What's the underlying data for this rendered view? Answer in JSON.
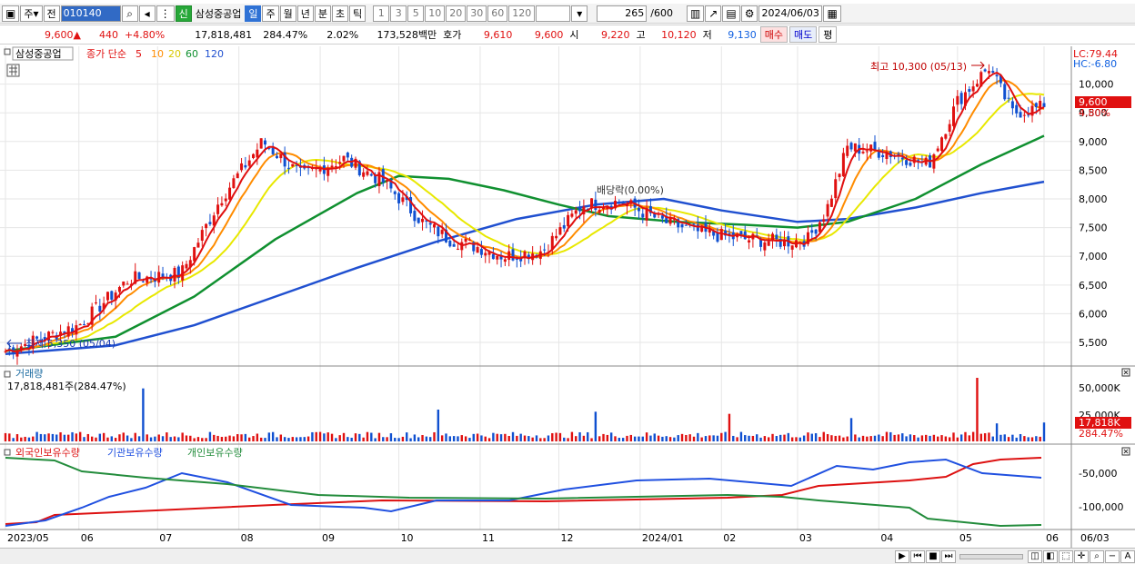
{
  "toolbar": {
    "market": "주",
    "period_btn": "전",
    "code": "010140",
    "stock_name": "삼성중공업",
    "new_badge": "신",
    "periods": [
      "일",
      "주",
      "월",
      "년",
      "분",
      "초",
      "틱"
    ],
    "selected_period": "일",
    "ticks": [
      "1",
      "3",
      "5",
      "10",
      "20",
      "30",
      "60",
      "120"
    ],
    "count": "265",
    "total": "/600",
    "date": "2024/06/03"
  },
  "quote": {
    "price": "9,600▲",
    "change": "440",
    "change_pct": "+4.80%",
    "volume": "17,818,481",
    "vol_ratio": "284.47%",
    "turnover_rate": "2.02%",
    "amount": "173,528백만",
    "hoga_label": "호가",
    "ask": "9,610",
    "bid": "9,600",
    "open_label": "시",
    "open": "9,220",
    "high_label": "고",
    "high": "10,120",
    "low_label": "저",
    "low": "9,130",
    "buy_btn": "매수",
    "sell_btn": "매도",
    "avg_btn": "평"
  },
  "legend": {
    "name": "삼성중공업",
    "ma_label": "종가 단순",
    "periods": [
      "5",
      "10",
      "20",
      "60",
      "120"
    ],
    "ma_colors": [
      "#e01010",
      "#ff8c00",
      "#e8e800",
      "#109030",
      "#2050d0"
    ]
  },
  "annotations": {
    "high": "최고 10,300 (05/13)",
    "low": "최저 5,350 (05/04)",
    "dividend": "배당락(0.00%)",
    "lc": "LC:79.44",
    "hc": "HC:-6.80",
    "price_tag": "9,600",
    "pct_tag": "4.80%"
  },
  "volume_panel": {
    "title": "거래량",
    "value": "17,818,481주(284.47%)",
    "tag": "17,818K",
    "tag_pct": "284.47%",
    "ticks": [
      "50,000K",
      "25,000K"
    ]
  },
  "holding_panel": {
    "legends": [
      "외국인보유수량",
      "기관보유수량",
      "개인보유수량"
    ],
    "colors": [
      "#dd1111",
      "#2050e0",
      "#238c3c"
    ],
    "ticks": [
      "-50,000",
      "-100,000"
    ]
  },
  "x_labels": [
    "2023/05",
    "06",
    "07",
    "08",
    "09",
    "10",
    "11",
    "12",
    "2024/01",
    "02",
    "03",
    "04",
    "05",
    "06",
    "06/03"
  ],
  "chart_data": {
    "type": "candlestick",
    "y_ticks": [
      10000,
      9500,
      9000,
      8500,
      8000,
      7500,
      7000,
      6500,
      6000,
      5500
    ],
    "y_tick_labels": [
      "10,000",
      "9,500",
      "9,000",
      "8,500",
      "8,000",
      "7,500",
      "7,000",
      "6,500",
      "6,000",
      "5,500"
    ],
    "ylim": [
      5200,
      10500
    ],
    "months": [
      "2023/05",
      "06",
      "07",
      "08",
      "09",
      "10",
      "11",
      "12",
      "2024/01",
      "02",
      "03",
      "04",
      "05",
      "06"
    ],
    "close_path_x": [
      "2023-05-04",
      "2023-06-01",
      "2023-06-20",
      "2023-07-10",
      "2023-07-25",
      "2023-08-10",
      "2023-08-25",
      "2023-09-10",
      "2023-09-25",
      "2023-10-10",
      "2023-10-20",
      "2023-11-01",
      "2023-11-10",
      "2023-11-25",
      "2023-12-10",
      "2023-12-25",
      "2024-01-10",
      "2024-01-25",
      "2024-02-10",
      "2024-02-25",
      "2024-03-05",
      "2024-03-12",
      "2024-03-20",
      "2024-04-05",
      "2024-04-20",
      "2024-05-01",
      "2024-05-13",
      "2024-05-22",
      "2024-06-03"
    ],
    "close_path_y": [
      5350,
      5800,
      6600,
      6700,
      8000,
      9000,
      8400,
      8700,
      8300,
      7600,
      7300,
      7150,
      7000,
      7100,
      7900,
      7950,
      7600,
      7400,
      7300,
      7250,
      7300,
      7800,
      8900,
      8800,
      8600,
      9700,
      10300,
      9500,
      9600
    ],
    "ma60_x": [
      "2023-05-04",
      "2023-06-15",
      "2023-07-15",
      "2023-08-15",
      "2023-09-15",
      "2023-10-01",
      "2023-10-20",
      "2023-11-10",
      "2023-12-01",
      "2023-12-20",
      "2024-01-15",
      "2024-02-10",
      "2024-03-01",
      "2024-03-20",
      "2024-04-15",
      "2024-05-10",
      "2024-06-03"
    ],
    "ma60_y": [
      5350,
      5600,
      6300,
      7300,
      8100,
      8400,
      8350,
      8150,
      7900,
      7700,
      7600,
      7550,
      7500,
      7600,
      8000,
      8600,
      9100
    ],
    "ma120_x": [
      "2023-05-04",
      "2023-06-15",
      "2023-07-15",
      "2023-08-15",
      "2023-09-15",
      "2023-10-15",
      "2023-11-15",
      "2023-12-15",
      "2024-01-10",
      "2024-02-01",
      "2024-03-01",
      "2024-03-20",
      "2024-04-15",
      "2024-05-10",
      "2024-06-03"
    ],
    "ma120_y": [
      5300,
      5450,
      5800,
      6300,
      6800,
      7250,
      7650,
      7900,
      8000,
      7800,
      7600,
      7650,
      7850,
      8100,
      8300
    ],
    "volume_ylim": [
      0,
      60000
    ],
    "holding_series": [
      {
        "name": "외국인보유수량"
      },
      {
        "name": "기관보유수량"
      },
      {
        "name": "개인보유수량"
      }
    ]
  }
}
